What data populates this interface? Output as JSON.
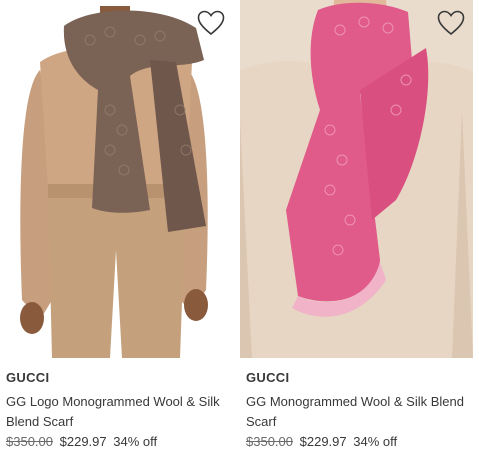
{
  "products": [
    {
      "brand": "GUCCI",
      "name": "GG Logo Monogrammed Wool & Silk Blend Scarf",
      "original_price": "$350.00",
      "sale_price": "$229.97",
      "discount": "34% off",
      "image_alt": "GG Logo Monogrammed Wool & Silk Blend Scarf",
      "scarf_color": "#7a6254"
    },
    {
      "brand": "GUCCI",
      "name": "GG Monogrammed Wool & Silk Blend Scarf",
      "original_price": "$350.00",
      "sale_price": "$229.97",
      "discount": "34% off",
      "image_alt": "GG Monogrammed Wool & Silk Blend Scarf",
      "scarf_color": "#e05a8a"
    }
  ],
  "icons": {
    "wishlist": "heart-outline-icon"
  }
}
